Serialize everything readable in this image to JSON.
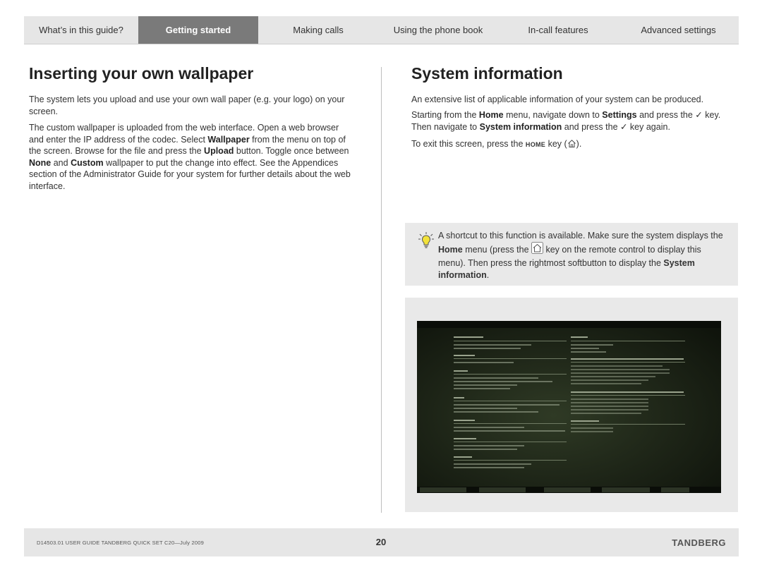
{
  "nav": {
    "tabs": [
      {
        "label": "What’s in this guide?",
        "active": false
      },
      {
        "label": "Getting started",
        "active": true
      },
      {
        "label": "Making calls",
        "active": false
      },
      {
        "label": "Using the phone book",
        "active": false
      },
      {
        "label": "In-call features",
        "active": false
      },
      {
        "label": "Advanced settings",
        "active": false
      }
    ]
  },
  "left": {
    "title": "Inserting your own wallpaper",
    "p1": "The system lets you upload and use your own wall paper (e.g. your logo) on your screen.",
    "p2": {
      "t1": "The custom wallpaper is uploaded from the web interface. Open a web browser and enter the IP address of the codec. Select ",
      "b1": "Wallpaper",
      "t2": " from the menu on top of the screen. Browse for the file and press the ",
      "b2": "Upload",
      "t3": " button. Toggle once between ",
      "b3": "None",
      "t4": " and ",
      "b4": "Custom",
      "t5": " wallpaper to put the change into effect. See the Appendices section of the Administrator Guide for your system for further details about the web interface."
    }
  },
  "right": {
    "title": "System information",
    "p1": "An extensive list of applicable information of your system can be produced.",
    "p2": {
      "t1": "Starting from the ",
      "b1": "Home",
      "t2": " menu, navigate down to ",
      "b2": "Settings",
      "t3": " and press the ✓ key. Then navigate to ",
      "b3": "System information",
      "t4": " and press the ✓ key again."
    },
    "p3": {
      "t1": "To exit this screen, press the ",
      "key": "HOME",
      "t2": " key (",
      "t3": ")."
    }
  },
  "tip": {
    "t1": "A shortcut to this function is available. Make sure the system displays the ",
    "b1": "Home",
    "t2": " menu (press the ",
    "t3": " key on the remote control to display this menu). Then press the rightmost softbutton to display the ",
    "b2": "System information",
    "t4": "."
  },
  "footer": {
    "doc": "D14503.01 USER GUIDE TANDBERG QUICK SET C20—July 2009",
    "page": "20",
    "brand": "TANDBERG"
  },
  "icons": [
    "home-key-icon",
    "lightbulb-tip-icon",
    "checkmark-icon"
  ]
}
